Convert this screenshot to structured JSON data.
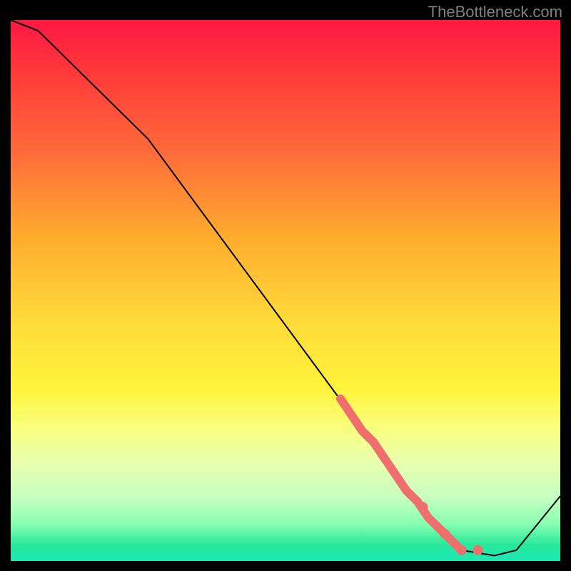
{
  "watermark": "TheBottleneck.com",
  "chart_data": {
    "type": "line",
    "title": "",
    "xlabel": "",
    "ylabel": "",
    "xlim": [
      0,
      100
    ],
    "ylim": [
      0,
      100
    ],
    "series": [
      {
        "name": "bottleneck-curve",
        "x": [
          0,
          5,
          25,
          70,
          75,
          80,
          82,
          88,
          92,
          100
        ],
        "values": [
          100,
          98,
          78,
          16,
          10,
          4,
          2,
          1,
          2,
          12
        ]
      }
    ],
    "highlight_segment": {
      "name": "marker-band",
      "x": [
        60,
        62,
        64,
        66,
        68,
        70,
        72,
        74,
        76,
        78,
        80,
        82
      ],
      "values": [
        30,
        27,
        24,
        22,
        19,
        16,
        13,
        11,
        8,
        6,
        4,
        2
      ]
    },
    "highlight_dots": {
      "name": "marker-dots",
      "x": [
        75,
        79,
        82,
        85
      ],
      "values": [
        10,
        5,
        2,
        2
      ]
    },
    "gradient_stops": [
      {
        "pos": 0,
        "color": "#ff1744"
      },
      {
        "pos": 25,
        "color": "#ff6d3a"
      },
      {
        "pos": 55,
        "color": "#ffd93a"
      },
      {
        "pos": 75,
        "color": "#faff7a"
      },
      {
        "pos": 97,
        "color": "#28e89a"
      },
      {
        "pos": 100,
        "color": "#1de9b6"
      }
    ]
  }
}
